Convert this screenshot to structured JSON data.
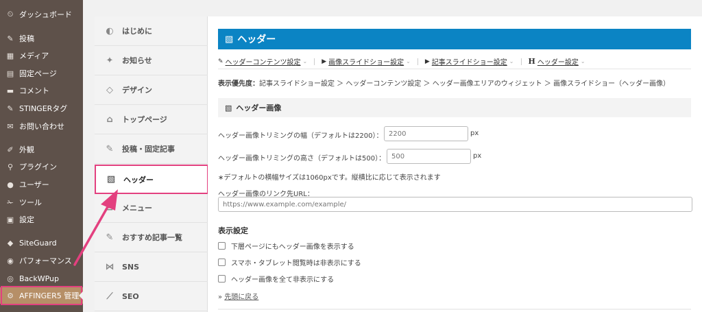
{
  "wp_menu": [
    {
      "icon": "dashboard-icon",
      "glyph": "⏲",
      "label": "ダッシュボード"
    },
    {
      "icon": "pin-icon",
      "glyph": "✎",
      "label": "投稿"
    },
    {
      "icon": "media-icon",
      "glyph": "▦",
      "label": "メディア"
    },
    {
      "icon": "page-icon",
      "glyph": "▤",
      "label": "固定ページ"
    },
    {
      "icon": "comment-icon",
      "glyph": "▬",
      "label": "コメント"
    },
    {
      "icon": "pin-icon",
      "glyph": "✎",
      "label": "STINGERタグ"
    },
    {
      "icon": "mail-icon",
      "glyph": "✉",
      "label": "お問い合わせ"
    },
    {
      "icon": "brush-icon",
      "glyph": "✐",
      "label": "外観"
    },
    {
      "icon": "plugin-icon",
      "glyph": "⚲",
      "label": "プラグイン"
    },
    {
      "icon": "user-icon",
      "glyph": "●",
      "label": "ユーザー"
    },
    {
      "icon": "wrench-icon",
      "glyph": "✁",
      "label": "ツール"
    },
    {
      "icon": "settings-icon",
      "glyph": "▣",
      "label": "設定"
    },
    {
      "icon": "siteguard-icon",
      "glyph": "◆",
      "label": "SiteGuard"
    },
    {
      "icon": "speedometer-icon",
      "glyph": "◉",
      "label": "パフォーマンス"
    },
    {
      "icon": "backwpup-icon",
      "glyph": "◎",
      "label": "BackWPup"
    },
    {
      "icon": "gear-icon",
      "glyph": "⚙",
      "label": "AFFINGER5 管理"
    }
  ],
  "settings_nav": [
    {
      "icon": "beginner-icon",
      "glyph": "◐",
      "label": "はじめに"
    },
    {
      "icon": "twitter-icon",
      "glyph": "✦",
      "label": "お知らせ"
    },
    {
      "icon": "diamond-icon",
      "glyph": "◇",
      "label": "デザイン"
    },
    {
      "icon": "home-icon",
      "glyph": "⌂",
      "label": "トップページ"
    },
    {
      "icon": "edit-icon",
      "glyph": "✎",
      "label": "投稿・固定記事"
    },
    {
      "icon": "image-icon",
      "glyph": "▧",
      "label": "ヘッダー"
    },
    {
      "icon": "menu-icon",
      "glyph": "≡",
      "label": "メニュー"
    },
    {
      "icon": "edit-box-icon",
      "glyph": "✎",
      "label": "おすすめ記事一覧"
    },
    {
      "icon": "share-icon",
      "glyph": "⋈",
      "label": "SNS"
    },
    {
      "icon": "chart-icon",
      "glyph": "⟋",
      "label": "SEO"
    }
  ],
  "main": {
    "title": "ヘッダー",
    "subnav": [
      {
        "icon": "edit-icon",
        "glyph": "✎",
        "label": "ヘッダーコンテンツ設定"
      },
      {
        "icon": "youtube-icon",
        "glyph": "▶",
        "label": "画像スライドショー設定"
      },
      {
        "icon": "youtube-icon",
        "glyph": "▶",
        "label": "記事スライドショー設定"
      },
      {
        "icon": "heading-icon",
        "glyph": "H",
        "label": "ヘッダー設定"
      }
    ],
    "priority_label": "表示優先度：",
    "priority_text": "記事スライドショー設定 ＞ ヘッダーコンテンツ設定 ＞ ヘッダー画像エリアのウィジェット ＞ 画像スライドショー（ヘッダー画像）",
    "section_title": "ヘッダー画像",
    "width_label": "ヘッダー画像トリミングの幅（デフォルトは2200）：",
    "width_placeholder": "2200",
    "height_label": "ヘッダー画像トリミングの高さ（デフォルトは500）：",
    "height_placeholder": "500",
    "unit": "px",
    "note": "∗デフォルトの横幅サイズは1060pxです。縦横比に応じて表示されます",
    "link_label": "ヘッダー画像のリンク先URL：",
    "link_placeholder": "https://www.example.com/example/",
    "display_title": "表示設定",
    "checkboxes": [
      "下層ページにもヘッダー画像を表示する",
      "スマホ・タブレット閲覧時は非表示にする",
      "ヘッダー画像を全て非表示にする"
    ],
    "back_top": "先頭に戻る"
  },
  "colors": {
    "accent": "#0b84c4",
    "highlight": "#e3407f",
    "wp_sidebar": "#5e514a"
  }
}
